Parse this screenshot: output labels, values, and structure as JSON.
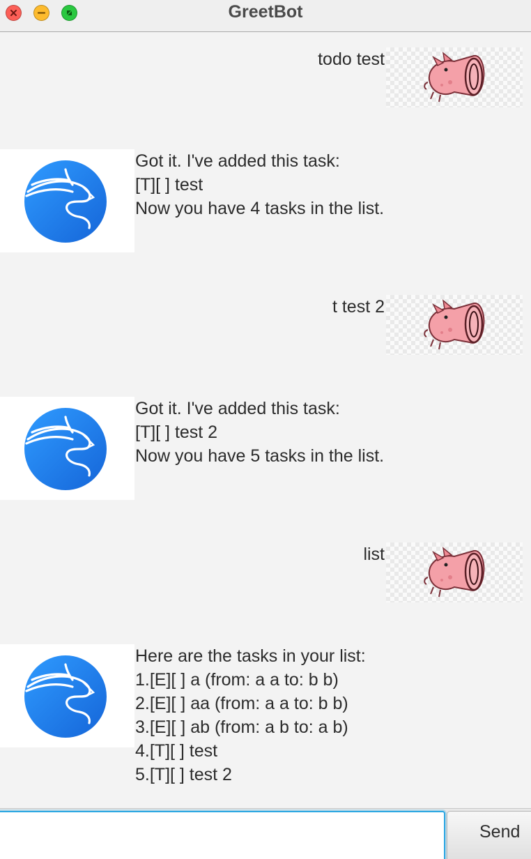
{
  "window": {
    "title": "GreetBot"
  },
  "messages": [
    {
      "sender": "user",
      "text": "todo test",
      "avatar_icon": "pig-icon"
    },
    {
      "sender": "bot",
      "text": "Got it. I've added this task:\n[T][ ] test\nNow you have 4 tasks in the list.",
      "avatar_icon": "dragon-logo-icon"
    },
    {
      "sender": "user",
      "text": "t test 2",
      "avatar_icon": "pig-icon"
    },
    {
      "sender": "bot",
      "text": "Got it. I've added this task:\n[T][ ] test 2\nNow you have 5 tasks in the list.",
      "avatar_icon": "dragon-logo-icon"
    },
    {
      "sender": "user",
      "text": "list",
      "avatar_icon": "pig-icon"
    },
    {
      "sender": "bot",
      "text": "Here are the tasks in your list:\n1.[E][ ] a (from: a a to: b b)\n2.[E][ ] aa (from: a a to: b b)\n3.[E][ ] ab (from: a b to: a b)\n4.[T][ ] test\n5.[T][ ] test 2",
      "avatar_icon": "dragon-logo-icon"
    }
  ],
  "input": {
    "value": "",
    "placeholder": ""
  },
  "send_button": {
    "label": "Send"
  },
  "colors": {
    "accent": "#2ba6e2",
    "bot_avatar_blue": "#1e88f0",
    "pig_pink": "#f4a0a8"
  }
}
